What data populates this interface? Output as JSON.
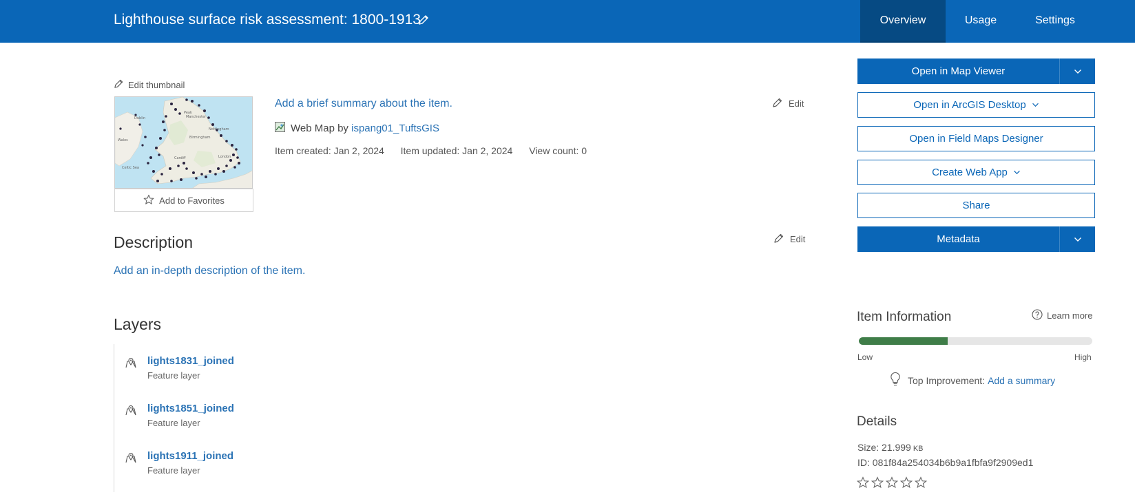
{
  "header": {
    "title": "Lighthouse surface risk assessment: 1800-1913",
    "tabs": [
      {
        "label": "Overview",
        "active": true
      },
      {
        "label": "Usage",
        "active": false
      },
      {
        "label": "Settings",
        "active": false
      }
    ],
    "colors": {
      "header_bg": "#0a66b7",
      "active_tab_bg": "#064a83"
    }
  },
  "thumbnail": {
    "edit_label": "Edit thumbnail",
    "favorites_label": "Add to Favorites"
  },
  "summary": {
    "link_text": "Add a brief summary about the item.",
    "edit_label": "Edit",
    "item_type": "Web Map",
    "by_label": "by",
    "owner": "ispang01_TuftsGIS",
    "created": "Item created: Jan 2, 2024",
    "updated": "Item updated: Jan 2, 2024",
    "views": "View count: 0"
  },
  "description": {
    "heading": "Description",
    "edit_label": "Edit",
    "link_text": "Add an in-depth description of the item."
  },
  "layers": {
    "heading": "Layers",
    "items": [
      {
        "name": "lights1831_joined",
        "type": "Feature layer"
      },
      {
        "name": "lights1851_joined",
        "type": "Feature layer"
      },
      {
        "name": "lights1911_joined",
        "type": "Feature layer"
      }
    ]
  },
  "actions": {
    "open_map_viewer": "Open in Map Viewer",
    "open_desktop": "Open in ArcGIS Desktop",
    "open_field_maps": "Open in Field Maps Designer",
    "create_web_app": "Create Web App",
    "share": "Share",
    "metadata": "Metadata"
  },
  "item_info": {
    "heading": "Item Information",
    "learn_more": "Learn more",
    "score_fraction": 0.38,
    "low_label": "Low",
    "high_label": "High",
    "improvement_label": "Top Improvement:",
    "improvement_link": "Add a summary",
    "bar_color": "#3f7d48"
  },
  "details": {
    "heading": "Details",
    "size_label": "Size: 21.999",
    "size_unit": "KB",
    "id_line": "ID: 081f84a254034b6b9a1fbfa9f2909ed1",
    "rating_stars": 0
  }
}
